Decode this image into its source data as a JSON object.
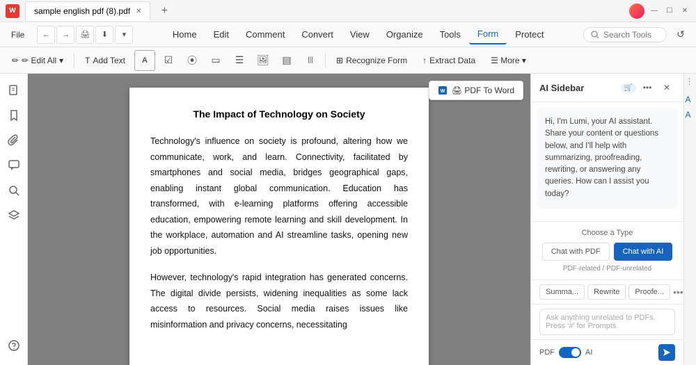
{
  "titlebar": {
    "app_icon": "W",
    "tab_label": "sample english pdf (8).pdf",
    "new_tab_icon": "+",
    "window_controls": [
      "—",
      "☐",
      "✕"
    ]
  },
  "menubar": {
    "file_label": "File",
    "nav_buttons": [
      "←",
      "→",
      "↑",
      "↓",
      "⬡"
    ],
    "items": [
      {
        "label": "Home",
        "active": false
      },
      {
        "label": "Edit",
        "active": false
      },
      {
        "label": "Comment",
        "active": false
      },
      {
        "label": "Convert",
        "active": false
      },
      {
        "label": "View",
        "active": false
      },
      {
        "label": "Organize",
        "active": false
      },
      {
        "label": "Tools",
        "active": false
      },
      {
        "label": "Form",
        "active": true
      },
      {
        "label": "Protect",
        "active": false
      }
    ],
    "search_placeholder": "Search Tools",
    "cloud_icon": "☁"
  },
  "toolbar": {
    "edit_all_label": "✏ Edit All",
    "add_text_label": "＋ Add Text",
    "icon_buttons": [
      "A",
      "☑",
      "⦿",
      "▭",
      "▣",
      "🖼",
      "▤",
      "☰"
    ],
    "recognize_form_label": "Recognize Form",
    "extract_data_label": "↑ Extract Data",
    "more_label": "More ▾"
  },
  "pdf": {
    "convert_btn": "🖨 PDF To Word",
    "title": "The Impact of Technology on Society",
    "paragraphs": [
      "Technology's influence on society is profound, altering how we communicate, work, and learn. Connectivity, facilitated by smartphones and social media, bridges geographical gaps, enabling instant global communication. Education has transformed, with e-learning platforms offering accessible education, empowering remote learning and skill development. In the workplace, automation and AI streamline tasks, opening new job opportunities.",
      "However, technology's rapid integration has generated concerns. The digital divide persists, widening inequalities as some lack access to resources. Social media raises issues like misinformation and privacy concerns, necessitating"
    ]
  },
  "left_sidebar": {
    "icons": [
      {
        "name": "page-icon",
        "symbol": "📄"
      },
      {
        "name": "bookmark-icon",
        "symbol": "🔖"
      },
      {
        "name": "attachment-icon",
        "symbol": "📎"
      },
      {
        "name": "comment-icon",
        "symbol": "💬"
      },
      {
        "name": "search-icon",
        "symbol": "🔍"
      },
      {
        "name": "layers-icon",
        "symbol": "⧉"
      }
    ],
    "bottom_icon": {
      "name": "help-icon",
      "symbol": "?"
    }
  },
  "ai_sidebar": {
    "title": "AI Sidebar",
    "badge": "🛒",
    "header_icons": [
      "•••",
      "✕"
    ],
    "message": "Hi, I'm Lumi, your AI assistant. Share your content or questions below, and I'll help with summarizing, proofreading, rewriting, or answering any queries. How can I assist you today?",
    "type_section": {
      "title": "Choose a Type",
      "buttons": [
        {
          "label": "Chat with PDF",
          "active": false
        },
        {
          "label": "Chat with AI",
          "active": true
        }
      ],
      "note": "PDF-related / PDF-unrelated"
    },
    "action_buttons": [
      {
        "label": "Summa..."
      },
      {
        "label": "Rewrite"
      },
      {
        "label": "Proofe..."
      }
    ],
    "input_placeholder": "Ask anything unrelated to PDFs. Press '#' for Prompts.",
    "footer": {
      "pdf_label": "PDF",
      "ai_label": "AI",
      "send_icon": "➤"
    }
  }
}
